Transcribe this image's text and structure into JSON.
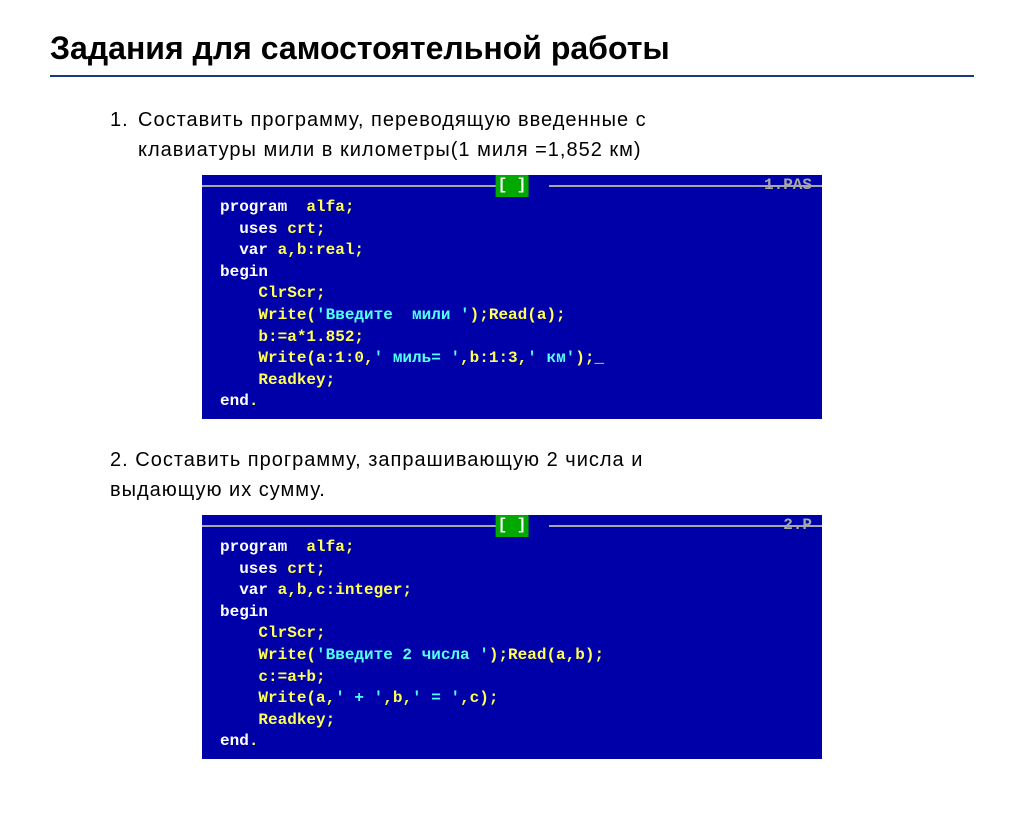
{
  "title": "Задания для самостоятельной работы",
  "task1": {
    "num": "1.",
    "text_line1": "Составить  программу,  переводящую  введенные  с",
    "text_line2": "клавиатуры  мили  в  километры(1  миля =1,852  км)"
  },
  "code1": {
    "filename": "1.PAS",
    "titleblock": "[ ]",
    "lines": {
      "l1_kw": "program",
      "l1_id": "  alfa;",
      "l2_kw": "  uses",
      "l2_id": " crt;",
      "l3_kw": "  var",
      "l3_id": " a,b:real;",
      "l4_kw": "begin",
      "l5_id": "    ClrScr;",
      "l6_id": "    Write(",
      "l6_str": "'Введите  мили '",
      "l6_id2": ");Read(a);",
      "l7_id": "    b:=a*1.852;",
      "l8_id": "    Write(a:1:0,",
      "l8_str": "' миль= '",
      "l8_id2": ",b:1:3,",
      "l8_str2": "' км'",
      "l8_id3": ");",
      "l8_cursor": "_",
      "l9_id": "    Readkey;",
      "l10_kw": "end",
      "l10_id": "."
    }
  },
  "task2": {
    "num": "2.",
    "text_line1": "Составить  программу,  запрашивающую  2  числа  и",
    "text_line2": "выдающую  их  сумму."
  },
  "code2": {
    "filename": "2.P",
    "titleblock": "[ ]",
    "lines": {
      "l1_kw": "program",
      "l1_id": "  alfa;",
      "l2_kw": "  uses",
      "l2_id": " crt;",
      "l3_kw": "  var",
      "l3_id": " a,b,c:integer;",
      "l4_kw": "begin",
      "l5_id": "    ClrScr;",
      "l6_id": "    Write(",
      "l6_str": "'Введите 2 числа '",
      "l6_id2": ");Read(a,b);",
      "l7_id": "    c:=a+b;",
      "l8_id": "    Write(a,",
      "l8_str": "' + '",
      "l8_id2": ",b,",
      "l8_str2": "' = '",
      "l8_id3": ",c);",
      "l9_id": "    Readkey;",
      "l10_kw": "end",
      "l10_id": "."
    }
  }
}
